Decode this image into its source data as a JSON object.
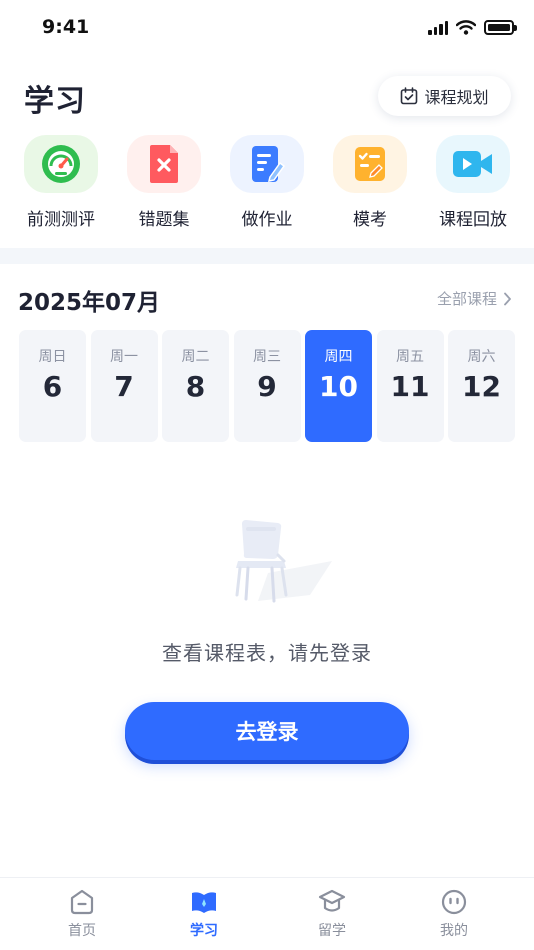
{
  "status_bar": {
    "time": "9:41"
  },
  "header": {
    "title": "学习",
    "plan_button_label": "课程规划"
  },
  "shortcuts": [
    {
      "label": "前测测评",
      "icon": "gauge-icon"
    },
    {
      "label": "错题集",
      "icon": "wrong-answers-icon"
    },
    {
      "label": "做作业",
      "icon": "homework-icon"
    },
    {
      "label": "模考",
      "icon": "mock-exam-icon"
    },
    {
      "label": "课程回放",
      "icon": "video-replay-icon"
    }
  ],
  "calendar": {
    "month": "2025年07月",
    "all_courses_label": "全部课程",
    "selected_day": "10",
    "days": [
      {
        "weekday": "周日",
        "date": "6"
      },
      {
        "weekday": "周一",
        "date": "7"
      },
      {
        "weekday": "周二",
        "date": "8"
      },
      {
        "weekday": "周三",
        "date": "9"
      },
      {
        "weekday": "周四",
        "date": "10"
      },
      {
        "weekday": "周五",
        "date": "11"
      },
      {
        "weekday": "周六",
        "date": "12"
      }
    ]
  },
  "empty_state": {
    "illustration": "chair-illustration",
    "message": "查看课程表，请先登录",
    "login_button_label": "去登录"
  },
  "tabbar": {
    "active": "学习",
    "tabs": [
      {
        "label": "首页",
        "icon": "home-icon"
      },
      {
        "label": "学习",
        "icon": "book-icon"
      },
      {
        "label": "留学",
        "icon": "graduation-cap-icon"
      },
      {
        "label": "我的",
        "icon": "profile-icon"
      }
    ]
  },
  "colors": {
    "accent": "#2f6bff",
    "text_primary": "#1f2233",
    "text_secondary": "#9aa0ae",
    "day_background": "#f3f5f9"
  }
}
